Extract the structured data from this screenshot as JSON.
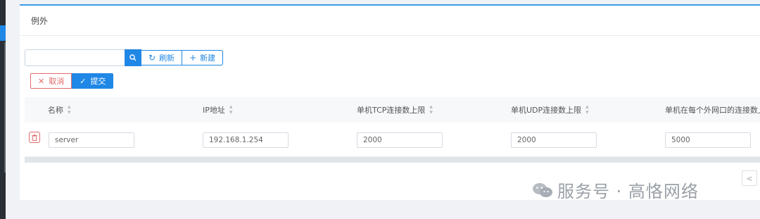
{
  "panel": {
    "title": "例外"
  },
  "toolbar": {
    "search_placeholder": "",
    "refresh_label": "刷新",
    "new_label": "新建"
  },
  "actions": {
    "cancel_label": "取消",
    "submit_label": "提交"
  },
  "table": {
    "columns": [
      "名称",
      "IP地址",
      "单机TCP连接数上限",
      "单机UDP连接数上限",
      "单机在每个外网口的连接数上限"
    ],
    "rows": [
      {
        "name": "server",
        "ip": "192.168.1.254",
        "tcp": "2000",
        "udp": "2000",
        "per_wan": "5000"
      }
    ]
  },
  "pagination": {
    "prev_glyph": "<"
  },
  "watermark": {
    "text": "服务号 · 高恪网络"
  },
  "colors": {
    "accent": "#1f87e5",
    "danger": "#e46a6a"
  }
}
